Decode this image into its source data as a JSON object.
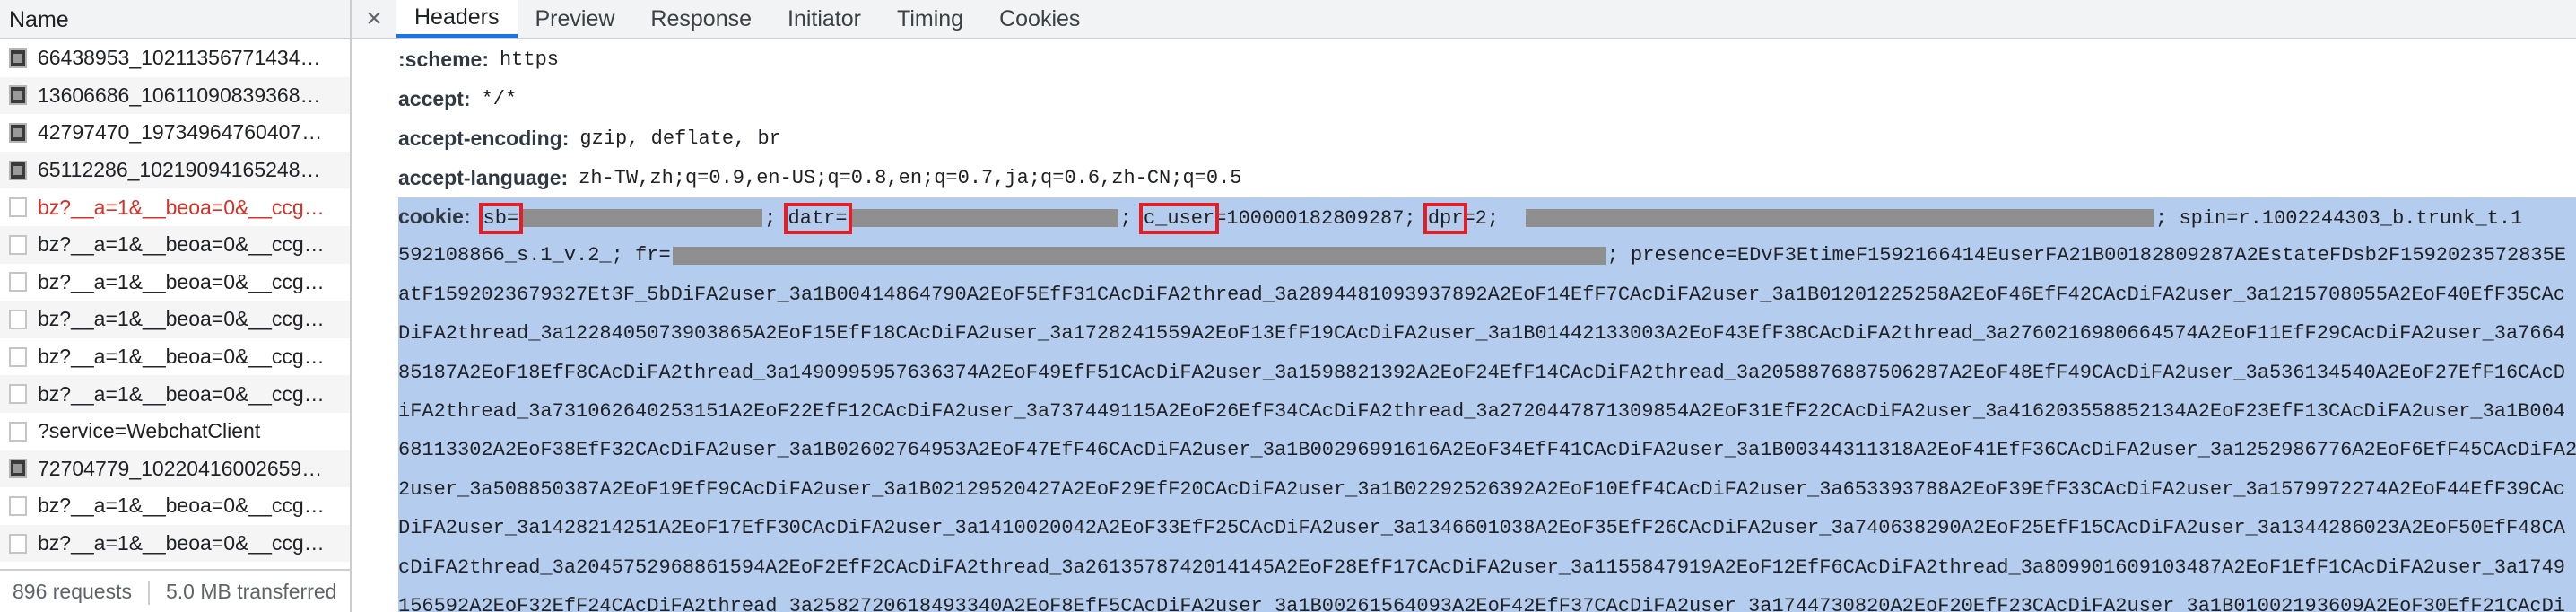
{
  "left_panel": {
    "header": "Name",
    "requests": [
      {
        "label": "66438953_10211356771434…",
        "icon": "image-icon",
        "error": false
      },
      {
        "label": "13606686_10611090839368…",
        "icon": "image-icon",
        "error": false
      },
      {
        "label": "42797470_19734964760407…",
        "icon": "image-icon",
        "error": false
      },
      {
        "label": "65112286_10219094165248…",
        "icon": "image-icon",
        "error": false
      },
      {
        "label": "bz?__a=1&__beoa=0&__ccg…",
        "icon": "document-icon",
        "error": true
      },
      {
        "label": "bz?__a=1&__beoa=0&__ccg…",
        "icon": "document-icon",
        "error": false
      },
      {
        "label": "bz?__a=1&__beoa=0&__ccg…",
        "icon": "document-icon",
        "error": false
      },
      {
        "label": "bz?__a=1&__beoa=0&__ccg…",
        "icon": "document-icon",
        "error": false
      },
      {
        "label": "bz?__a=1&__beoa=0&__ccg…",
        "icon": "document-icon",
        "error": false
      },
      {
        "label": "bz?__a=1&__beoa=0&__ccg…",
        "icon": "document-icon",
        "error": false
      },
      {
        "label": "?service=WebchatClient",
        "icon": "document-icon",
        "error": false
      },
      {
        "label": "72704779_10220416002659…",
        "icon": "image-icon",
        "error": false
      },
      {
        "label": "bz?__a=1&__beoa=0&__ccg…",
        "icon": "document-icon",
        "error": false
      },
      {
        "label": "bz?__a=1&__beoa=0&__ccg…",
        "icon": "document-icon",
        "error": false
      }
    ],
    "footer": {
      "requests": "896 requests",
      "transferred": "5.0 MB transferred"
    }
  },
  "tabs": [
    "Headers",
    "Preview",
    "Response",
    "Initiator",
    "Timing",
    "Cookies"
  ],
  "active_tab": "Headers",
  "close_glyph": "×",
  "headers": [
    {
      "name": ":scheme:",
      "value": "https"
    },
    {
      "name": "accept:",
      "value": "*/*"
    },
    {
      "name": "accept-encoding:",
      "value": "gzip, deflate, br"
    },
    {
      "name": "accept-language:",
      "value": "zh-TW,zh;q=0.9,en-US;q=0.8,en;q=0.7,ja;q=0.6,zh-CN;q=0.5"
    }
  ],
  "cookie": {
    "name": "cookie:",
    "line1": {
      "sb_key": "sb=",
      "sep1": "; ",
      "datr_key": "datr=",
      "sep2": "; ",
      "c_user_key": "c_user",
      "c_user_val": "=100000182809287; ",
      "dpr_key": "dpr",
      "dpr_val": "=2;",
      "spin": "; spin=r.1002244303_b.trunk_t.1"
    },
    "line2": {
      "prefix": "592108866_s.1_v.2_; fr=",
      "suffix": "; presence=EDvF3EtimeF1592166414EuserFA21B00182809287A2EstateFDsb2F1592023572835E"
    },
    "lines": [
      "atF1592023679327Et3F_5bDiFA2user_3a1B00414864790A2EoF5EfF31CAcDiFA2thread_3a2894481093937892A2EoF14EfF7CAcDiFA2user_3a1B01201225258A2EoF46EfF42CAcDiFA2user_3a1215708055A2EoF40EfF35CAc",
      "DiFA2thread_3a1228405073903865A2EoF15EfF18CAcDiFA2user_3a1728241559A2EoF13EfF19CAcDiFA2user_3a1B01442133003A2EoF43EfF38CAcDiFA2thread_3a2760216980664574A2EoF11EfF29CAcDiFA2user_3a7664",
      "85187A2EoF18EfF8CAcDiFA2thread_3a1490995957636374A2EoF49EfF51CAcDiFA2user_3a1598821392A2EoF24EfF14CAcDiFA2thread_3a2058876887506287A2EoF48EfF49CAcDiFA2user_3a536134540A2EoF27EfF16CAcD",
      "iFA2thread_3a731062640253151A2EoF22EfF12CAcDiFA2user_3a737449115A2EoF26EfF34CAcDiFA2thread_3a2720447871309854A2EoF31EfF22CAcDiFA2user_3a416203558852134A2EoF23EfF13CAcDiFA2user_3a1B004",
      "68113302A2EoF38EfF32CAcDiFA2user_3a1B02602764953A2EoF47EfF46CAcDiFA2user_3a1B00296991616A2EoF34EfF41CAcDiFA2user_3a1B00344311318A2EoF41EfF36CAcDiFA2user_3a1252986776A2EoF6EfF45CAcDiFA2",
      "2user_3a508850387A2EoF19EfF9CAcDiFA2user_3a1B02129520427A2EoF29EfF20CAcDiFA2user_3a1B02292526392A2EoF10EfF4CAcDiFA2user_3a653393788A2EoF39EfF33CAcDiFA2user_3a1579972274A2EoF44EfF39CAc",
      "DiFA2user_3a1428214251A2EoF17EfF30CAcDiFA2user_3a1410020042A2EoF33EfF25CAcDiFA2user_3a1346601038A2EoF35EfF26CAcDiFA2user_3a740638290A2EoF25EfF15CAcDiFA2user_3a1344286023A2EoF50EfF48CA",
      "cDiFA2thread_3a2045752968861594A2EoF2EfF2CAcDiFA2thread_3a2613578742014145A2EoF28EfF17CAcDiFA2user_3a1155847919A2EoF12EfF6CAcDiFA2thread_3a809901609103487A2EoF1EfF1CAcDiFA2user_3a1749",
      "156592A2EoF32EfF24CAcDiFA2thread_3a2582720618493340A2EoF8EfF5CAcDiFA2user_3a1B00261564093A2EoF42EfF37CAcDiFA2user_3a1744730820A2EoF20EfF23CAcDiFA2user_3a1B01002193609A2EoF30EfF21CAcDi"
    ]
  }
}
